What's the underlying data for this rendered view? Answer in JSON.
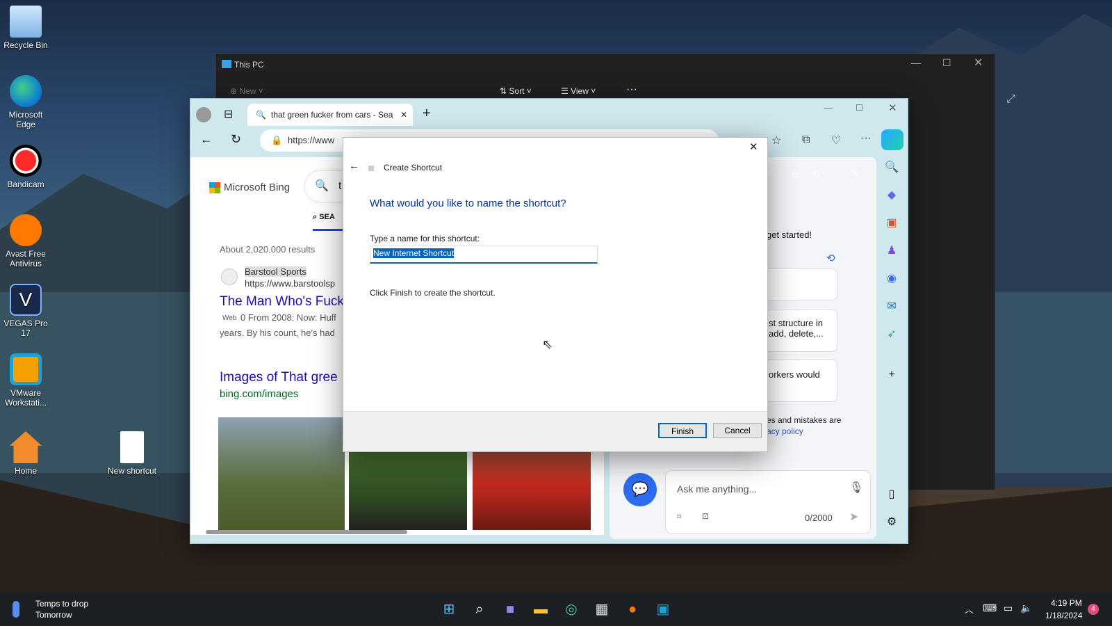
{
  "desktop": {
    "icons": [
      {
        "label": "Recycle Bin",
        "icon": "recycle-bin-icon"
      },
      {
        "label": "Microsoft Edge",
        "icon": "edge-icon"
      },
      {
        "label": "Bandicam",
        "icon": "bandicam-icon"
      },
      {
        "label": "Avast Free Antivirus",
        "icon": "avast-icon"
      },
      {
        "label": "VEGAS Pro 17",
        "icon": "vegas-icon"
      },
      {
        "label": "VMware Workstati...",
        "icon": "vmware-icon"
      },
      {
        "label": "Home",
        "icon": "home-icon"
      },
      {
        "label": "New shortcut",
        "icon": "file-shortcut-icon"
      }
    ]
  },
  "explorer": {
    "title": "This PC",
    "toolbar": {
      "new": "New",
      "sort": "Sort",
      "view": "View"
    }
  },
  "edge": {
    "tab_title": "that green fucker from cars - Sea",
    "url": "https://www",
    "bing": {
      "brand": "Microsoft Bing",
      "search_char": "t",
      "tab_search": "SEA",
      "results_count": "About 2,020,000 results",
      "result1": {
        "site": "Barstool Sports",
        "url": "https://www.barstoolsp",
        "title": "The Man Who's Fuck",
        "badge": "Web",
        "snippet1": "0 From 2008: Now: Huff",
        "snippet2": "years. By his count, he's had"
      },
      "images": {
        "title": "Images of That gree",
        "url": "bing.com/images"
      }
    },
    "copilot": {
      "greeting": "get started!",
      "card1": "st structure in add, delete,...",
      "card2": "orkers would",
      "disclaimer": "es and mistakes are",
      "privacy": "acy policy",
      "input_placeholder": "Ask me anything...",
      "counter": "0/2000"
    }
  },
  "dialog": {
    "title": "Create Shortcut",
    "heading": "What would you like to name the shortcut?",
    "label": "Type a name for this shortcut:",
    "value": "New Internet Shortcut",
    "hint": "Click Finish to create the shortcut.",
    "finish": "Finish",
    "cancel": "Cancel"
  },
  "taskbar": {
    "weather_line1": "Temps to drop",
    "weather_line2": "Tomorrow",
    "time": "4:19 PM",
    "date": "1/18/2024",
    "notif_count": "4"
  },
  "colors": {
    "accent": "#0067c0",
    "heading": "#003399",
    "link": "#1a0dab"
  }
}
